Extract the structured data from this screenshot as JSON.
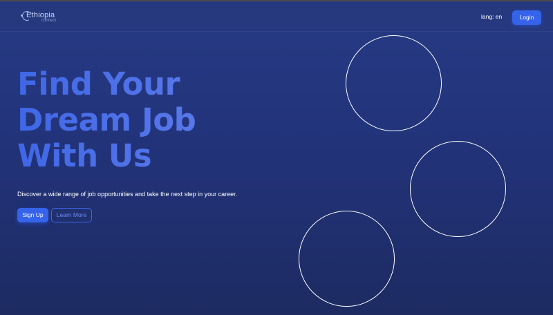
{
  "nav": {
    "logo_text": "Ethiopia",
    "logo_sub": "connect",
    "lang_label": "lang: en",
    "login_label": "Login"
  },
  "hero": {
    "headline_line1": "Find Your",
    "headline_line2": "Dream Job",
    "headline_line3": "With Us",
    "subtitle": "Discover a wide range of job opportunities and take the next step in your career.",
    "signup_label": "Sign Up",
    "learn_more_label": "Learn More"
  },
  "colors": {
    "background": "#24367c",
    "accent": "#3563e9",
    "headline": "#4b6ee8",
    "circle_stroke": "#ffffff"
  }
}
